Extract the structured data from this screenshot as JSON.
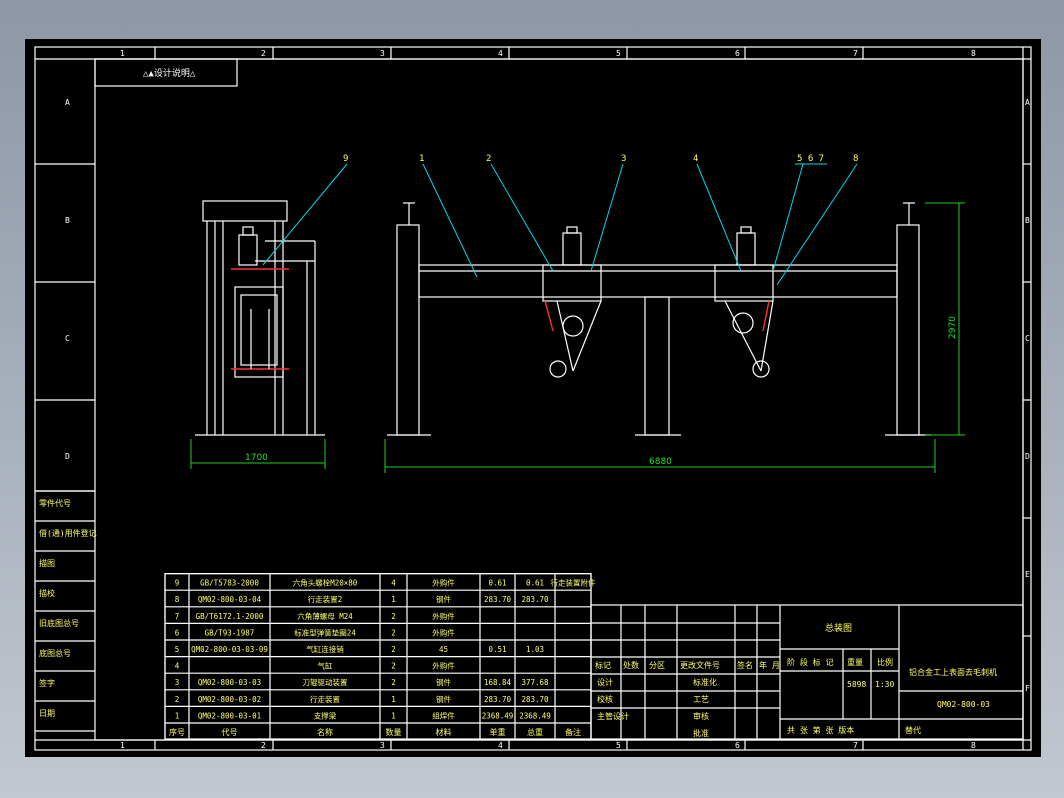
{
  "colors": {
    "background": "#000000",
    "line": "#ffffff",
    "leader": "#00d8e8",
    "dimension": "#20d020",
    "text": "#ffff66",
    "accent": "#ff3030"
  },
  "border": {
    "columns": [
      "1",
      "2",
      "3",
      "4",
      "5",
      "6",
      "7",
      "8"
    ],
    "rows": [
      "A",
      "B",
      "C",
      "D",
      "E",
      "F"
    ]
  },
  "top_label": "△▲设计说明△",
  "callouts": [
    "9",
    "1",
    "2",
    "3",
    "4",
    "5 6 7",
    "8"
  ],
  "dimensions": {
    "height": "2970",
    "width_side": "1700",
    "width_total": "6880"
  },
  "left_column": [
    "零件代号",
    "借(通)用件登记",
    "描图",
    "描校",
    "旧底图总号",
    "底图总号",
    "签字",
    "日期"
  ],
  "bom": {
    "headers": [
      "序号",
      "代号",
      "名称",
      "数量",
      "材料",
      "单重",
      "总重",
      "备注"
    ],
    "rows": [
      [
        "9",
        "GB/T5783-2000",
        "六角头螺栓M20×80",
        "4",
        "外购件",
        "0.61",
        "0.61",
        "行走装置附件"
      ],
      [
        "8",
        "QM02-800-03-04",
        "行走装置2",
        "1",
        "钢件",
        "283.70",
        "283.70",
        ""
      ],
      [
        "7",
        "GB/T6172.1-2000",
        "六角薄螺母 M24",
        "2",
        "外购件",
        "",
        "",
        ""
      ],
      [
        "6",
        "GB/T93-1987",
        "标准型弹簧垫圈24",
        "2",
        "外购件",
        "",
        "",
        ""
      ],
      [
        "5",
        "QM02-800-03-03-09",
        "气缸连接销",
        "2",
        "45",
        "0.51",
        "1.03",
        ""
      ],
      [
        "4",
        "",
        "气缸",
        "2",
        "外购件",
        "",
        "",
        ""
      ],
      [
        "3",
        "QM02-800-03-03",
        "刀辊驱动装置",
        "2",
        "钢件",
        "168.84",
        "377.68",
        ""
      ],
      [
        "2",
        "QM02-800-03-02",
        "行走装置",
        "1",
        "钢件",
        "283.70",
        "283.70",
        ""
      ],
      [
        "1",
        "QM02-800-03-01",
        "支撑梁",
        "1",
        "组焊件",
        "2368.49",
        "2368.49",
        ""
      ]
    ]
  },
  "title_block": {
    "drawing_name": "总装图",
    "product": "铝合金工上表面去毛刺机",
    "code": "QM02-800-03",
    "weight": "5898",
    "scale": "1:30",
    "rev_headers": [
      "标记",
      "处数",
      "分区",
      "更改文件号",
      "签名",
      "年 月"
    ],
    "roles": [
      "设计",
      "校核",
      "主管设计"
    ],
    "roles2": [
      "标准化",
      "工艺",
      "审核",
      "批准"
    ],
    "stage_label": "阶 段 标 记",
    "weight_label": "重量",
    "scale_label": "比例",
    "sheet_label": "共  张  第  张  版本",
    "replace_label": "替代"
  }
}
